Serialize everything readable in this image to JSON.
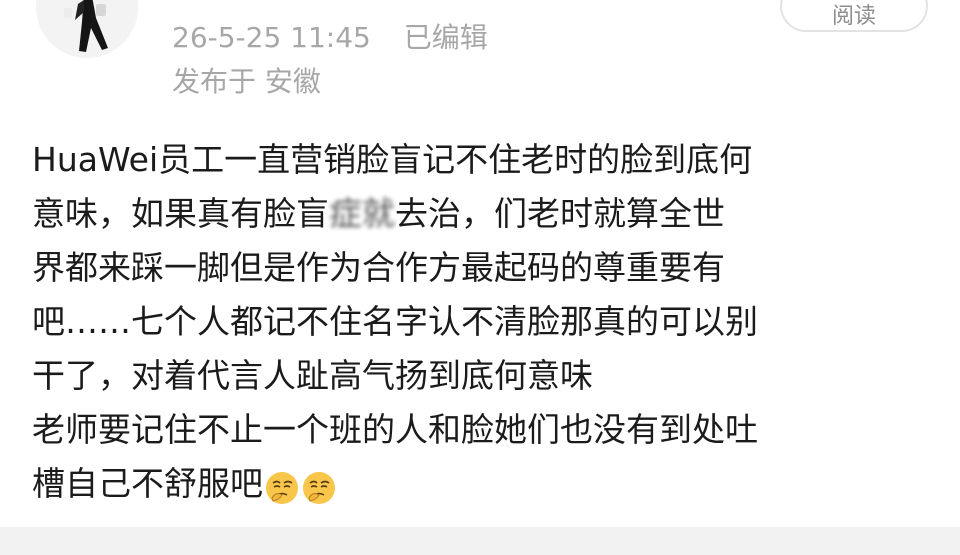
{
  "header": {
    "timestamp": "26-5-25 11:45",
    "edited_label": "已编辑",
    "location": "发布于 安徽",
    "read_button_label": "阅读"
  },
  "post": {
    "lines": [
      {
        "pre": "HuaWei员工一直营销脸盲记不住老时的脸到底何",
        "blur": "",
        "post": ""
      },
      {
        "pre": "意味，如果真有脸盲",
        "blur": "症就",
        "post": "去治，们老时就算全世"
      },
      {
        "pre": "界都来踩一脚但是作为合作方最起码的尊重要有",
        "blur": "",
        "post": ""
      },
      {
        "pre": "吧……七个人都记不住名字认不清脸那真的可以别",
        "blur": "",
        "post": ""
      },
      {
        "pre": "干了，对着代言人趾高气扬到底何意味",
        "blur": "",
        "post": ""
      },
      {
        "pre": "老师要记住不止一个班的人和脸她们也没有到处吐",
        "blur": "",
        "post": ""
      },
      {
        "pre": "槽自己不舒服吧",
        "blur": "",
        "post": ""
      }
    ],
    "emojis": [
      "thinking-face-icon",
      "thinking-face-icon"
    ]
  },
  "colors": {
    "meta_text": "#a7a7a7",
    "body_text": "#1b1b1b",
    "emoji_yellow": "#f7c64a",
    "bottom_bar": "#f2f2f2"
  }
}
